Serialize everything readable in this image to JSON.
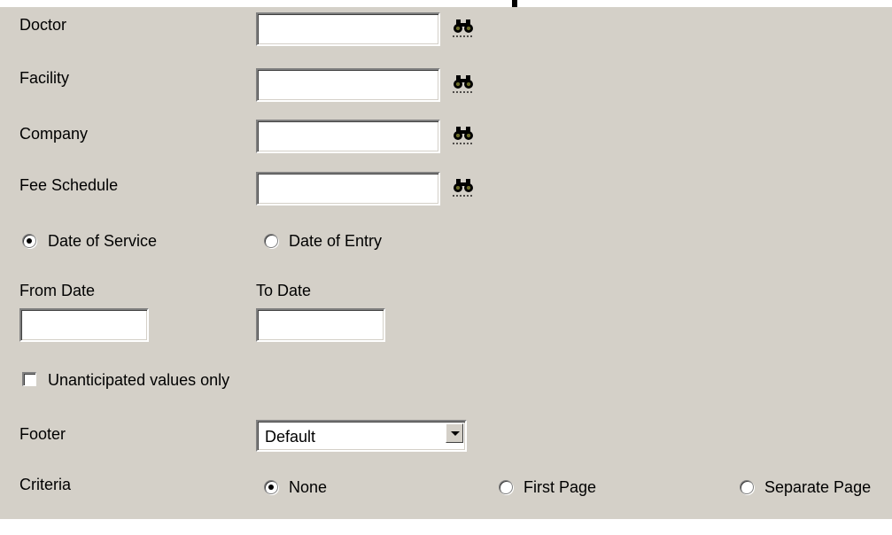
{
  "labels": {
    "doctor": "Doctor",
    "facility": "Facility",
    "company": "Company",
    "fee_schedule": "Fee Schedule",
    "from_date": "From Date",
    "to_date": "To Date",
    "footer": "Footer",
    "criteria": "Criteria"
  },
  "fields": {
    "doctor": "",
    "facility": "",
    "company": "",
    "fee_schedule": "",
    "from_date": "",
    "to_date": ""
  },
  "date_type": {
    "options": [
      "Date of Service",
      "Date of Entry"
    ],
    "selected": "Date of Service"
  },
  "unanticipated": {
    "label": "Unanticipated values only",
    "checked": false
  },
  "footer_select": {
    "value": "Default"
  },
  "criteria_options": {
    "options": [
      "None",
      "First Page",
      "Separate Page"
    ],
    "selected": "None"
  },
  "icons": {
    "lookup": "binoculars-icon",
    "dropdown": "chevron-down-icon"
  },
  "colors": {
    "panel_bg": "#d4d0c8",
    "field_bg": "#ffffff",
    "icon_olive": "#6b6b2a"
  }
}
